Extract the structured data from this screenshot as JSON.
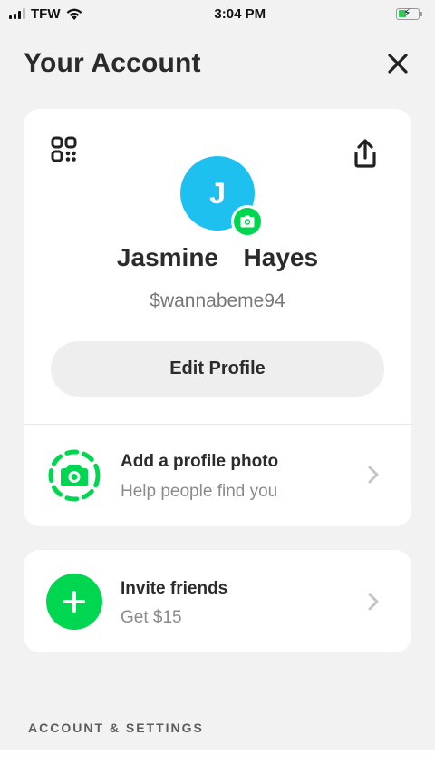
{
  "status_bar": {
    "carrier": "TFW",
    "time": "3:04 PM",
    "battery_level": 0.4
  },
  "header": {
    "title": "Your Account",
    "close_icon": "close-icon"
  },
  "profile": {
    "avatar_initial": "J",
    "avatar_color": "#1ec0f0",
    "name": "Jasmine  Hayes",
    "handle": "$wannabeme94",
    "edit_button_label": "Edit Profile",
    "icons": {
      "qr": "qr-code-icon",
      "share": "share-icon",
      "camera": "camera-icon"
    }
  },
  "add_photo": {
    "title": "Add a profile photo",
    "subtitle": "Help people find you"
  },
  "invite": {
    "title": "Invite friends",
    "subtitle": "Get $15"
  },
  "sections": {
    "account_settings_label": "ACCOUNT & SETTINGS"
  },
  "colors": {
    "accent_green": "#00d64f",
    "background": "#f2f2f2",
    "card": "#ffffff"
  }
}
